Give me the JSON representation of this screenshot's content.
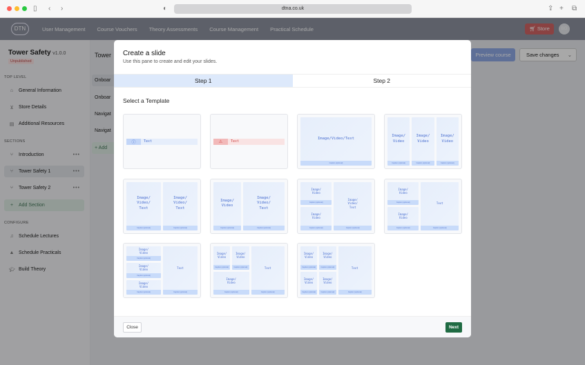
{
  "browser": {
    "url": "dtna.co.uk"
  },
  "nav": {
    "logo": "DTN",
    "links": [
      "User Management",
      "Course Vouchers",
      "Theory Assessments",
      "Course Management",
      "Practical Schedule"
    ],
    "store": "Store",
    "avatar": "BG"
  },
  "sidebar": {
    "course_title": "Tower Safety",
    "version": "v1.0.0",
    "status": "Unpublished",
    "top_level_heading": "TOP LEVEL",
    "top_level": [
      {
        "label": "General Information",
        "icon": "home-icon"
      },
      {
        "label": "Store Details",
        "icon": "cart-icon"
      },
      {
        "label": "Additional Resources",
        "icon": "document-icon"
      }
    ],
    "sections_heading": "SECTIONS",
    "sections": [
      {
        "label": "Introduction"
      },
      {
        "label": "Tower Safety 1",
        "active": true
      },
      {
        "label": "Tower Safety 2"
      }
    ],
    "add_section": "Add Section",
    "configure_heading": "CONFIGURE",
    "configure": [
      {
        "label": "Schedule Lectures"
      },
      {
        "label": "Schedule Practicals"
      },
      {
        "label": "Build Theory"
      }
    ]
  },
  "main": {
    "title": "Tower",
    "slides": [
      "Onboar",
      "Onboar",
      "Navigat",
      "Navigat"
    ],
    "add": "+ Add",
    "preview": "Preview course",
    "save": "Save changes"
  },
  "modal": {
    "title": "Create a slide",
    "subtitle": "Use this pane to create and edit your slides.",
    "steps": [
      {
        "label": "Step 1",
        "active": true
      },
      {
        "label": "Step 2",
        "active": false
      }
    ],
    "select_label": "Select a Template",
    "caption": "Caption (optional)",
    "templates": [
      {
        "type": "info",
        "text": "Text"
      },
      {
        "type": "warning",
        "text": "Text"
      },
      {
        "layout": "single",
        "panels": [
          "Image/Video/Text"
        ]
      },
      {
        "layout": "3col",
        "panels": [
          "Image/\nVideo",
          "Image/\nVideo",
          "Image/\nVideo"
        ]
      },
      {
        "layout": "2col",
        "panels": [
          "Image/\nVideo/\nText",
          "Image/\nVideo/\nText"
        ]
      },
      {
        "layout": "nw",
        "panels": [
          "Image/\nVideo",
          "Image/\nVideo/\nText"
        ]
      },
      {
        "layout": "s2",
        "panels": [
          "Image/\nVideo",
          "Image/\nVideo",
          "Image/\nVideo/\nText"
        ]
      },
      {
        "layout": "s2",
        "panels": [
          "Image/\nVideo",
          "Image/\nVideo",
          "Text"
        ]
      },
      {
        "layout": "s3",
        "panels": [
          "Image/\nVideo",
          "Image/\nVideo",
          "Image/\nVideo",
          "Text"
        ]
      },
      {
        "layout": "21",
        "panels": [
          "Image/\nVideo",
          "Image/\nVideo",
          "Image/\nVideo",
          "Text"
        ]
      },
      {
        "layout": "g4",
        "panels": [
          "Image/\nVideo",
          "Image/\nVideo",
          "Image/\nVideo",
          "Image/\nVideo",
          "Text"
        ]
      }
    ],
    "close": "Close",
    "next": "Next"
  },
  "colors": {
    "nav": "#2f3544",
    "accent": "#4a6fd0",
    "step_active": "#dde9fb",
    "next": "#1f6b43",
    "store": "#b33a3a"
  }
}
